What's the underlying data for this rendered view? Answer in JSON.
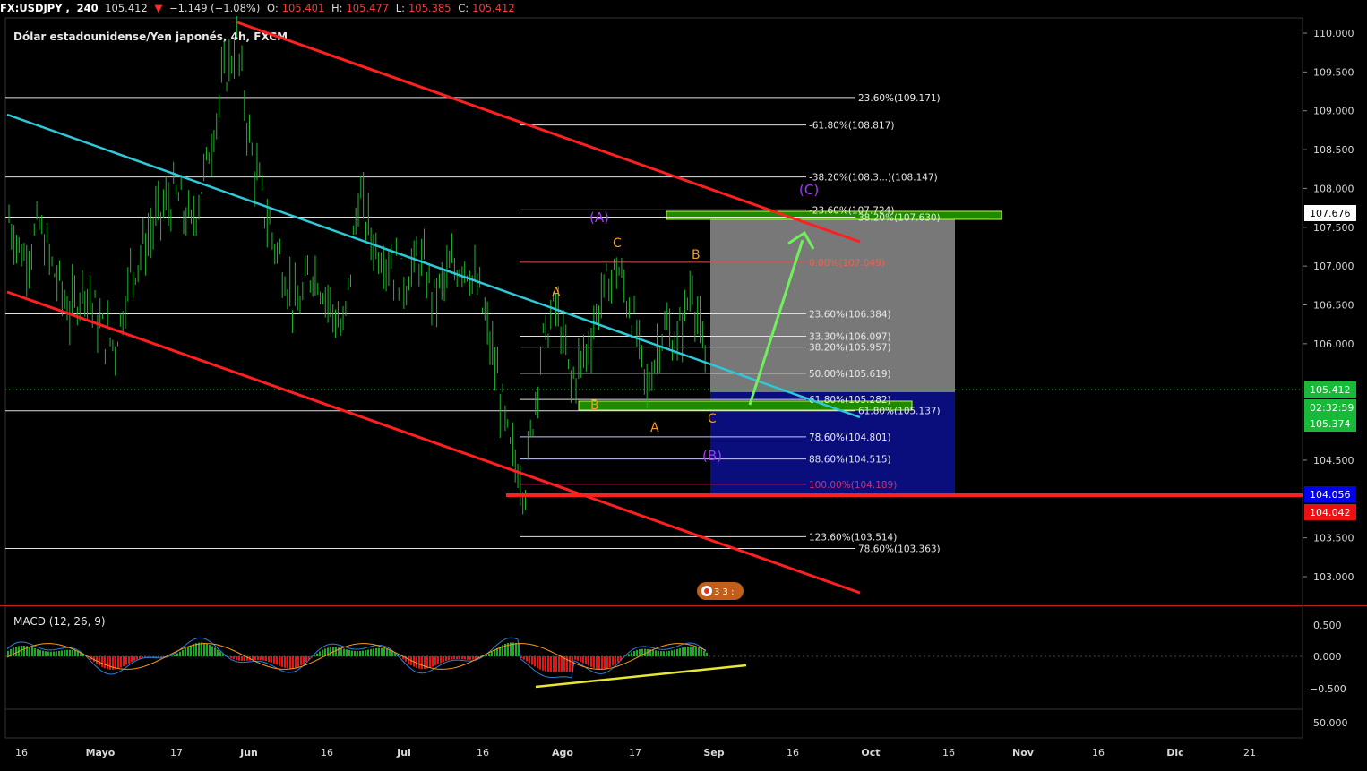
{
  "header": {
    "symbol": "FX:USDJPY",
    "interval": "240",
    "last": "105.412",
    "change": "−1.149 (−1.08%)",
    "o_label": "O:",
    "o_value": "105.401",
    "h_label": "H:",
    "h_value": "105.477",
    "l_label": "L:",
    "l_value": "105.385",
    "c_label": "C:",
    "c_value": "105.412"
  },
  "chart_title": "Dólar estadounidense/Yen japonés, 4h, FXCM",
  "chart_data": [
    {
      "type": "line",
      "title": "Dólar estadounidense/Yen japonés, 4h, FXCM",
      "ylim": [
        102.8,
        110.1
      ],
      "y_ticks": [
        "110.000",
        "109.500",
        "109.000",
        "108.500",
        "108.000",
        "107.500",
        "107.000",
        "106.500",
        "106.000",
        "104.500",
        "103.500",
        "103.000"
      ],
      "x_ticks": [
        "16",
        "Mayo",
        "17",
        "Jun",
        "16",
        "Jul",
        "16",
        "Ago",
        "17",
        "Sep",
        "16",
        "Oct",
        "16",
        "Nov",
        "16",
        "Dic",
        "21"
      ],
      "series": [
        {
          "values": [
            107.6,
            107.1,
            107.5,
            106.9,
            106.4,
            106.8,
            106.2,
            106.0,
            106.9,
            107.3,
            107.7,
            107.9,
            107.5,
            108.3,
            109.3,
            109.9,
            108.4,
            107.6,
            107.0,
            106.4,
            107.0,
            106.6,
            106.1,
            107.9,
            107.3,
            107.1,
            106.8,
            107.1,
            106.6,
            106.9,
            107.1,
            106.6,
            105.7,
            104.6,
            104.2,
            105.9,
            106.5,
            105.5,
            105.9,
            106.6,
            107.0,
            106.4,
            105.4,
            106.2,
            106.0,
            106.8,
            105.4
          ]
        }
      ],
      "price_labels": [
        "107.676",
        "105.412",
        "02:32:59",
        "105.374",
        "104.056",
        "104.042"
      ],
      "fibonacci_levels": [
        {
          "label": "23.60%(109.171)",
          "y": 109.171
        },
        {
          "label": "-61.80%(108.817)",
          "y": 108.817
        },
        {
          "label": "-38.20%(108.3...)",
          "y": 108.147,
          "extra": "(108.147)"
        },
        {
          "label": "-23.60%(107.724)",
          "y": 107.724
        },
        {
          "label": "38.20%(107.630)",
          "y": 107.63
        },
        {
          "label": "0.00%(107.049)",
          "y": 107.049
        },
        {
          "label": "23.60%(106.384)",
          "y": 106.384
        },
        {
          "label": "33.30%(106.097)",
          "y": 106.097
        },
        {
          "label": "38.20%(105.957)",
          "y": 105.957
        },
        {
          "label": "50.00%(105.619)",
          "y": 105.619
        },
        {
          "label": "61.80%(105.282)",
          "y": 105.282
        },
        {
          "label": "61.80%(105.137)",
          "y": 105.137
        },
        {
          "label": "78.60%(104.801)",
          "y": 104.801
        },
        {
          "label": "88.60%(104.515)",
          "y": 104.515
        },
        {
          "label": "100.00%(104.189)",
          "y": 104.189
        },
        {
          "label": "123.60%(103.514)",
          "y": 103.514
        },
        {
          "label": "78.60%(103.363)",
          "y": 103.363
        }
      ],
      "wave_labels": [
        "A",
        "B",
        "C",
        "A",
        "B",
        "C",
        "(A)",
        "(B)",
        "(C)"
      ],
      "support_level": 104.056
    },
    {
      "type": "line",
      "title": "MACD (12, 26, 9)",
      "ylim": [
        -0.7,
        0.7
      ],
      "y_ticks": [
        "0.500",
        "0.000",
        "−0.500"
      ]
    }
  ],
  "lower_pane": {
    "y_tick": "50.000"
  },
  "colors": {
    "channel": "#ff1f1f",
    "trendline": "#2ec8d8",
    "candle": "#1fb82f",
    "projection_arrow": "#6ff05c",
    "support": "#ff1f1f",
    "divergence": "#e8e833",
    "wave_orange": "#f59a1a",
    "wave_purple": "#9f3cf0"
  }
}
